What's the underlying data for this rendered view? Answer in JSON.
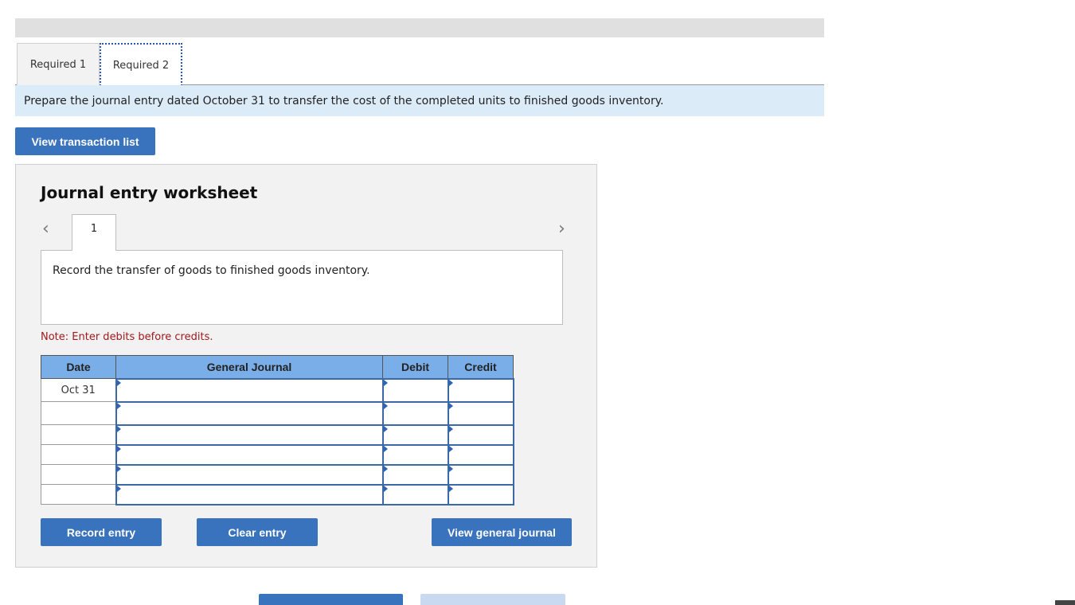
{
  "tabs": [
    {
      "label": "Required 1"
    },
    {
      "label": "Required 2"
    }
  ],
  "instruction": "Prepare the journal entry dated October 31 to transfer the cost of the completed units to finished goods inventory.",
  "view_transaction_list": "View transaction list",
  "worksheet": {
    "title": "Journal entry worksheet",
    "entry_number": "1",
    "prev_icon": "chevron-left-icon",
    "next_icon": "chevron-right-icon",
    "description": "Record the transfer of goods to finished goods inventory.",
    "note": "Note: Enter debits before credits.",
    "columns": [
      "Date",
      "General Journal",
      "Debit",
      "Credit"
    ],
    "rows": [
      {
        "date": "Oct 31"
      },
      {
        "date": ""
      },
      {
        "date": ""
      },
      {
        "date": ""
      },
      {
        "date": ""
      },
      {
        "date": ""
      }
    ],
    "buttons": {
      "record": "Record entry",
      "clear": "Clear entry",
      "view_general_journal": "View general journal"
    }
  },
  "colors": {
    "button_blue": "#3a73bd",
    "header_blue": "#7aaee8",
    "note_red": "#a3181c",
    "instruction_bg": "#dcebf8"
  }
}
